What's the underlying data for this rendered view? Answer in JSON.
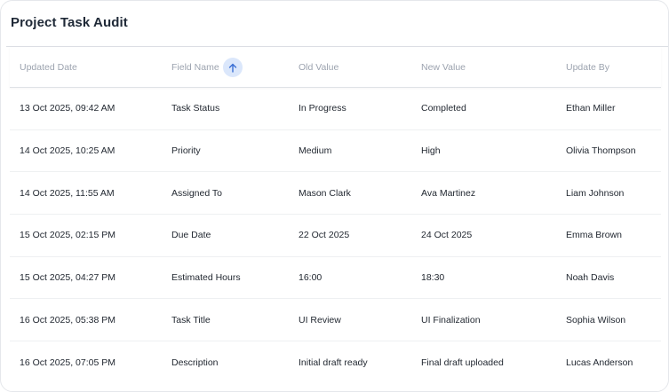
{
  "title": "Project Task Audit",
  "columns": [
    "Updated Date",
    "Field Name",
    "Old Value",
    "New Value",
    "Update By"
  ],
  "rows": [
    {
      "date": "13 Oct 2025, 09:42 AM",
      "field": "Task Status",
      "old": "In Progress",
      "new": "Completed",
      "by": "Ethan Miller"
    },
    {
      "date": "14 Oct 2025, 10:25 AM",
      "field": "Priority",
      "old": "Medium",
      "new": "High",
      "by": "Olivia Thompson"
    },
    {
      "date": "14 Oct 2025, 11:55 AM",
      "field": "Assigned To",
      "old": "Mason Clark",
      "new": "Ava Martinez",
      "by": "Liam Johnson"
    },
    {
      "date": "15 Oct 2025, 02:15 PM",
      "field": "Due Date",
      "old": "22 Oct 2025",
      "new": "24 Oct 2025",
      "by": "Emma Brown"
    },
    {
      "date": "15 Oct 2025, 04:27 PM",
      "field": "Estimated Hours",
      "old": "16:00",
      "new": "18:30",
      "by": "Noah Davis"
    },
    {
      "date": "16 Oct 2025, 05:38 PM",
      "field": "Task Title",
      "old": "UI Review",
      "new": "UI Finalization",
      "by": "Sophia Wilson"
    },
    {
      "date": "16 Oct 2025, 07:05 PM",
      "field": "Description",
      "old": "Initial draft ready",
      "new": "Final draft uploaded",
      "by": "Lucas Anderson"
    }
  ],
  "sort": {
    "column": "Field Name",
    "direction": "ascending",
    "icon": "arrow-up-icon"
  },
  "colors": {
    "sort_bg": "#dbe7fb",
    "sort_arrow": "#3b6fd4"
  }
}
